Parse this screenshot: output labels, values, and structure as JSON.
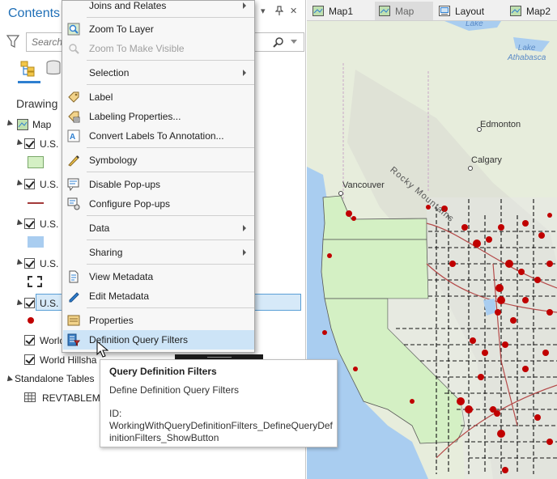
{
  "contents": {
    "title": "Contents",
    "search_placeholder": "Search",
    "drawing_order": "Drawing",
    "map_label": "Map",
    "layers": [
      {
        "label": "U.S. S",
        "checked": true
      },
      {
        "label": "U.S. R",
        "checked": true
      },
      {
        "label": "U.S. L",
        "checked": true
      },
      {
        "label": "U.S. C",
        "checked": true
      },
      {
        "label": "U.S. C",
        "checked": true,
        "selected": true
      },
      {
        "label": "World",
        "checked": true
      },
      {
        "label": "World Hillsha",
        "checked": true
      }
    ],
    "standalone_tables": "Standalone Tables",
    "table_name": "REVTABLEMA"
  },
  "tabs": [
    {
      "label": "Map1",
      "active": false
    },
    {
      "label": "Map",
      "active": true
    },
    {
      "label": "Layout",
      "active": false
    },
    {
      "label": "Map2",
      "active": false
    }
  ],
  "map": {
    "labels": {
      "lake": "Lake",
      "lake_athabasca": "Lake\nAthabasca",
      "edmonton": "Edmonton",
      "calgary": "Calgary",
      "vancouver": "Vancouver",
      "rocky_mountains": "Rocky Mountains"
    },
    "colors": {
      "states_fill": "#d4f0c4",
      "points": "#c00000",
      "water": "#a9cdf0"
    }
  },
  "context_menu": {
    "items": [
      {
        "label": "Joins and Relates",
        "icon": "joins-icon",
        "submenu": true
      },
      {
        "label": "Zoom To Layer",
        "icon": "zoom-to-layer-icon"
      },
      {
        "label": "Zoom To Make Visible",
        "icon": "zoom-visible-icon",
        "disabled": true
      },
      {
        "label": "Selection",
        "icon": "",
        "submenu": true
      },
      {
        "label": "Label",
        "icon": "label-icon"
      },
      {
        "label": "Labeling Properties...",
        "icon": "labeling-properties-icon"
      },
      {
        "label": "Convert Labels To Annotation...",
        "icon": "convert-labels-icon"
      },
      {
        "label": "Symbology",
        "icon": "symbology-icon"
      },
      {
        "label": "Disable Pop-ups",
        "icon": "disable-popups-icon"
      },
      {
        "label": "Configure Pop-ups",
        "icon": "configure-popups-icon"
      },
      {
        "label": "Data",
        "icon": "",
        "submenu": true
      },
      {
        "label": "Sharing",
        "icon": "",
        "submenu": true
      },
      {
        "label": "View Metadata",
        "icon": "view-metadata-icon"
      },
      {
        "label": "Edit Metadata",
        "icon": "edit-metadata-icon"
      },
      {
        "label": "Properties",
        "icon": "properties-icon"
      },
      {
        "label": "Definition Query Filters",
        "icon": "definition-query-icon",
        "hover": true
      }
    ]
  },
  "tooltip": {
    "title": "Query Definition Filters",
    "description": "Define Definition Query Filters",
    "id_label": "ID:",
    "id_value": "WorkingWithQueryDefinitionFilters_DefineQueryDefinitionFilters_ShowButton"
  }
}
